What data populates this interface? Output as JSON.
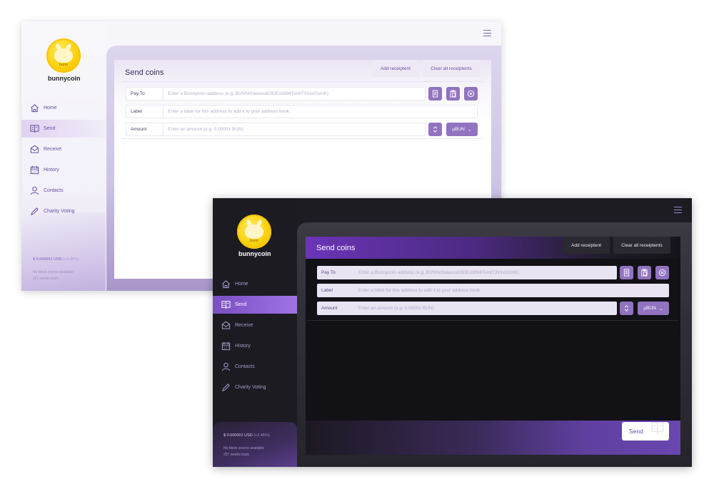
{
  "light": {
    "brand": "bunnycoin",
    "coin_ticker": "bunn",
    "nav": [
      {
        "label": "Home",
        "icon": "home-icon"
      },
      {
        "label": "Send",
        "icon": "send-icon"
      },
      {
        "label": "Receive",
        "icon": "receive-icon"
      },
      {
        "label": "History",
        "icon": "history-icon"
      },
      {
        "label": "Contacts",
        "icon": "contacts-icon"
      },
      {
        "label": "Charity Voting",
        "icon": "charity-voting-icon"
      }
    ],
    "balance": "$ 0.000001 USD",
    "balance_change": "(+2.46%)",
    "status_line1": "No block source available",
    "status_line2": "257 weeks back",
    "title": "Send coins",
    "add_btn": "Add receiptent",
    "clear_btn": "Clear all receiptents",
    "pay_to_label": "Pay To",
    "pay_to_placeholder": "Enter a Bunnycoin address (e.g. BUNNchaiaxxa53DEcb894TomIT3VxxCcmK)",
    "label_label": "Label",
    "label_placeholder": "Enter a label for this address to add it to your address book",
    "amount_label": "Amount",
    "amount_placeholder": "Enter an amount (e.g. 0.00001 BUN)",
    "unit": "µBUN"
  },
  "dark": {
    "brand": "bunnycoin",
    "coin_ticker": "bunn",
    "nav": [
      {
        "label": "Home",
        "icon": "home-icon"
      },
      {
        "label": "Send",
        "icon": "send-icon"
      },
      {
        "label": "Receive",
        "icon": "receive-icon"
      },
      {
        "label": "History",
        "icon": "history-icon"
      },
      {
        "label": "Contacts",
        "icon": "contacts-icon"
      },
      {
        "label": "Charity Voting",
        "icon": "charity-voting-icon"
      }
    ],
    "balance": "$ 0.000001 USD",
    "balance_change": "(+2.46%)",
    "status_line1": "No block source available",
    "status_line2": "257 weeks back",
    "title": "Send coins",
    "add_btn": "Add receiptent",
    "clear_btn": "Clear all receiptents",
    "pay_to_label": "Pay To",
    "pay_to_placeholder": "Enter a Bunnycoin address (e.g. BUNNchaiaxxa53DEcb894TomIT3VxxCcmK)",
    "label_label": "Label",
    "label_placeholder": "Enter a label for this address to add it to your address book",
    "amount_label": "Amount",
    "amount_placeholder": "Enter an amount (e.g. 0.00001 BUN)",
    "unit": "µBUN",
    "send_btn": "Send"
  },
  "colors": {
    "accent": "#9173c0",
    "active_nav_dark": "#8a5fd6",
    "coin_gold": "#fcd10f"
  }
}
